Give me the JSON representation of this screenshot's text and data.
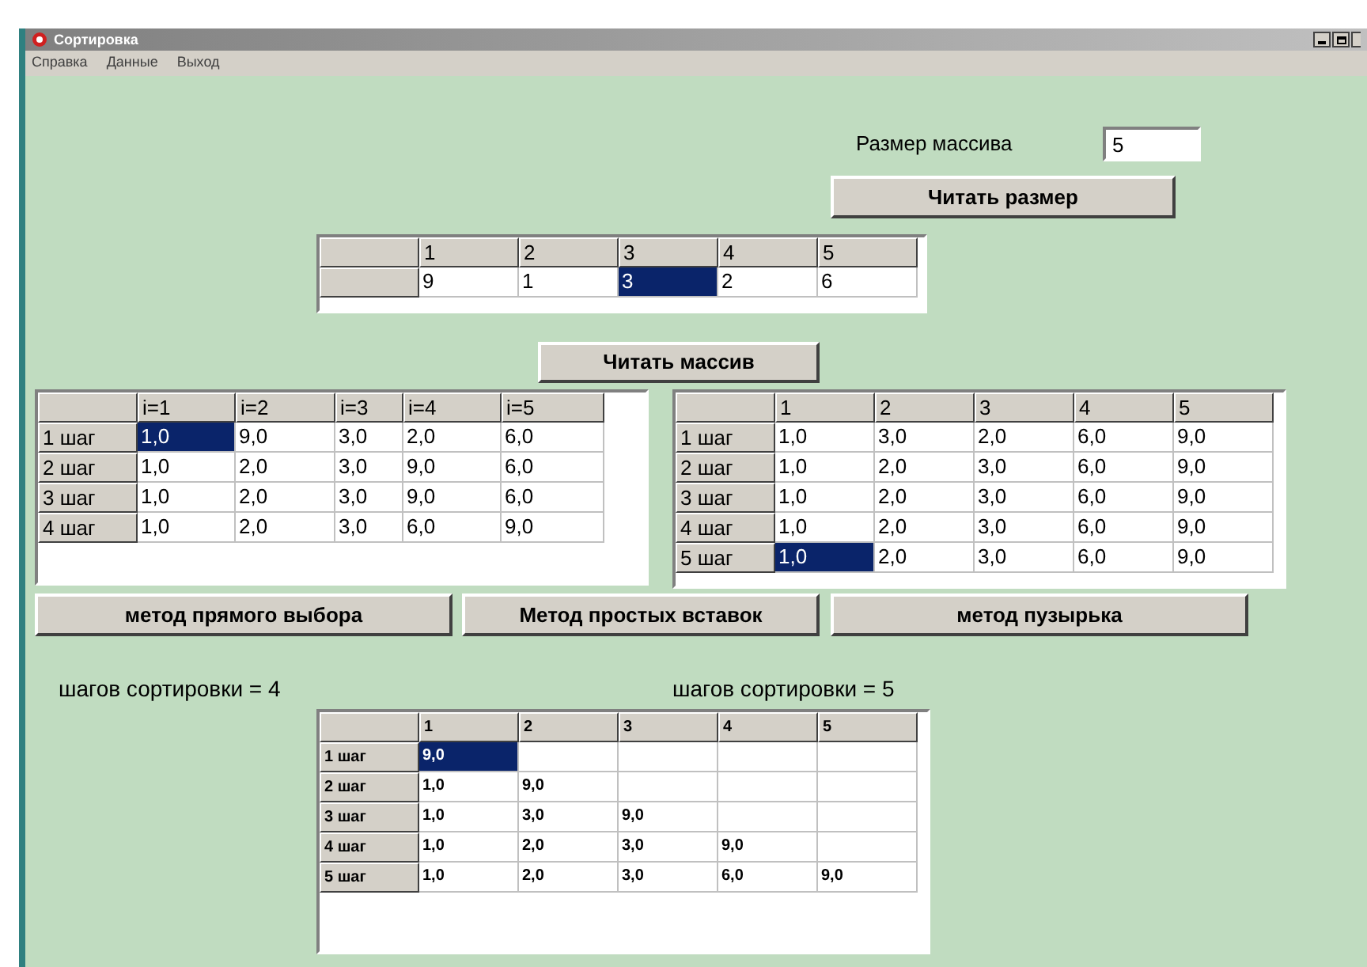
{
  "window": {
    "title": "Сортировка"
  },
  "menu": [
    "Справка",
    "Данные",
    "Выход"
  ],
  "size_field": {
    "label": "Размер массива",
    "value": "5"
  },
  "buttons": [
    {
      "label": "Читать размер"
    },
    {
      "label": "Читать массив"
    },
    {
      "label": "метод прямого выбора"
    },
    {
      "label": "Метод простых вставок"
    },
    {
      "label": "метод пузырька"
    }
  ],
  "step_labels": [
    "шагов сортировки = 4",
    "шагов сортировки = 5"
  ],
  "grids": [
    {
      "columns": [
        "1",
        "2",
        "3",
        "4",
        "5"
      ],
      "rows": [
        {
          "cells": [
            {
              "text": "9",
              "selected": false
            },
            {
              "text": "1",
              "selected": false
            },
            {
              "text": "3",
              "selected": true
            },
            {
              "text": "2",
              "selected": false
            },
            {
              "text": "6",
              "selected": false
            }
          ]
        }
      ]
    },
    {
      "columns": [
        "i=1",
        "i=2",
        "i=3",
        "i=4",
        "i=5"
      ],
      "rows": [
        {
          "header": "1 шаг",
          "cells": [
            {
              "text": "1,0",
              "selected": true
            },
            {
              "text": "9,0",
              "selected": false
            },
            {
              "text": "3,0",
              "selected": false
            },
            {
              "text": "2,0",
              "selected": false
            },
            {
              "text": "6,0",
              "selected": false
            }
          ]
        },
        {
          "header": "2 шаг",
          "cells": [
            {
              "text": "1,0",
              "selected": false
            },
            {
              "text": "2,0",
              "selected": false
            },
            {
              "text": "3,0",
              "selected": false
            },
            {
              "text": "9,0",
              "selected": false
            },
            {
              "text": "6,0",
              "selected": false
            }
          ]
        },
        {
          "header": "3 шаг",
          "cells": [
            {
              "text": "1,0",
              "selected": false
            },
            {
              "text": "2,0",
              "selected": false
            },
            {
              "text": "3,0",
              "selected": false
            },
            {
              "text": "9,0",
              "selected": false
            },
            {
              "text": "6,0",
              "selected": false
            }
          ]
        },
        {
          "header": "4 шаг",
          "cells": [
            {
              "text": "1,0",
              "selected": false
            },
            {
              "text": "2,0",
              "selected": false
            },
            {
              "text": "3,0",
              "selected": false
            },
            {
              "text": "6,0",
              "selected": false
            },
            {
              "text": "9,0",
              "selected": false
            }
          ]
        }
      ]
    },
    {
      "columns": [
        "1",
        "2",
        "3",
        "4",
        "5"
      ],
      "rows": [
        {
          "header": "1 шаг",
          "cells": [
            {
              "text": "1,0",
              "selected": false
            },
            {
              "text": "3,0",
              "selected": false
            },
            {
              "text": "2,0",
              "selected": false
            },
            {
              "text": "6,0",
              "selected": false
            },
            {
              "text": "9,0",
              "selected": false
            }
          ]
        },
        {
          "header": "2 шаг",
          "cells": [
            {
              "text": "1,0",
              "selected": false
            },
            {
              "text": "2,0",
              "selected": false
            },
            {
              "text": "3,0",
              "selected": false
            },
            {
              "text": "6,0",
              "selected": false
            },
            {
              "text": "9,0",
              "selected": false
            }
          ]
        },
        {
          "header": "3 шаг",
          "cells": [
            {
              "text": "1,0",
              "selected": false
            },
            {
              "text": "2,0",
              "selected": false
            },
            {
              "text": "3,0",
              "selected": false
            },
            {
              "text": "6,0",
              "selected": false
            },
            {
              "text": "9,0",
              "selected": false
            }
          ]
        },
        {
          "header": "4 шаг",
          "cells": [
            {
              "text": "1,0",
              "selected": false
            },
            {
              "text": "2,0",
              "selected": false
            },
            {
              "text": "3,0",
              "selected": false
            },
            {
              "text": "6,0",
              "selected": false
            },
            {
              "text": "9,0",
              "selected": false
            }
          ]
        },
        {
          "header": "5 шаг",
          "cells": [
            {
              "text": "1,0",
              "selected": true
            },
            {
              "text": "2,0",
              "selected": false
            },
            {
              "text": "3,0",
              "selected": false
            },
            {
              "text": "6,0",
              "selected": false
            },
            {
              "text": "9,0",
              "selected": false
            }
          ]
        }
      ]
    },
    {
      "columns": [
        "1",
        "2",
        "3",
        "4",
        "5"
      ],
      "rows": [
        {
          "header": "1 шаг",
          "cells": [
            {
              "text": "9,0",
              "selected": true
            }
          ]
        },
        {
          "header": "2 шаг",
          "cells": [
            {
              "text": "1,0",
              "selected": false
            },
            {
              "text": "9,0",
              "selected": false
            }
          ]
        },
        {
          "header": "3 шаг",
          "cells": [
            {
              "text": "1,0",
              "selected": false
            },
            {
              "text": "3,0",
              "selected": false
            },
            {
              "text": "9,0",
              "selected": false
            }
          ]
        },
        {
          "header": "4 шаг",
          "cells": [
            {
              "text": "1,0",
              "selected": false
            },
            {
              "text": "2,0",
              "selected": false
            },
            {
              "text": "3,0",
              "selected": false
            },
            {
              "text": "9,0",
              "selected": false
            }
          ]
        },
        {
          "header": "5 шаг",
          "cells": [
            {
              "text": "1,0",
              "selected": false
            },
            {
              "text": "2,0",
              "selected": false
            },
            {
              "text": "3,0",
              "selected": false
            },
            {
              "text": "6,0",
              "selected": false
            },
            {
              "text": "9,0",
              "selected": false
            }
          ]
        }
      ]
    }
  ]
}
